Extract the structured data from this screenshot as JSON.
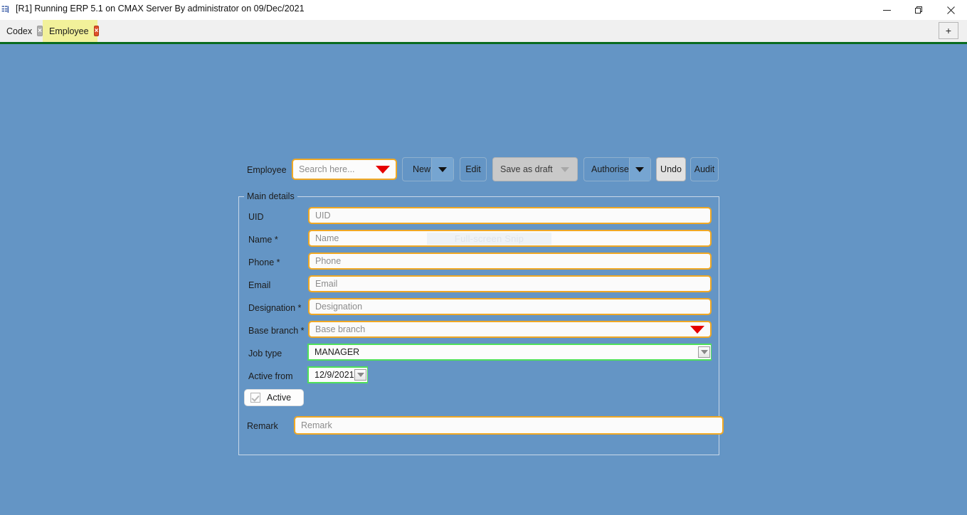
{
  "window": {
    "title": "[R1] Running ERP 5.1 on CMAX Server By administrator on 09/Dec/2021",
    "icon": "app-icon",
    "minimize_label": "Minimize",
    "restore_label": "Restore",
    "close_label": "Close"
  },
  "tabs": {
    "items": [
      {
        "label": "Codex",
        "active": false,
        "close_label": "×"
      },
      {
        "label": "Employee",
        "active": true,
        "close_label": "×"
      }
    ],
    "add_label": "+"
  },
  "toolbar": {
    "record_label": "Employee",
    "search_placeholder": "Search here...",
    "search_value": "",
    "new_label": "New",
    "edit_label": "Edit",
    "save_as_draft_label": "Save as draft",
    "authorise_label": "Authorise",
    "undo_label": "Undo",
    "audit_label": "Audit"
  },
  "main_details": {
    "group_title": "Main details",
    "fields": [
      {
        "label": "UID",
        "placeholder": "UID",
        "value": "",
        "type": "text"
      },
      {
        "label": "Name *",
        "placeholder": "Name",
        "value": "",
        "type": "text"
      },
      {
        "label": "Phone *",
        "placeholder": "Phone",
        "value": "",
        "type": "text"
      },
      {
        "label": "Email",
        "placeholder": "Email",
        "value": "",
        "type": "text"
      },
      {
        "label": "Designation *",
        "placeholder": "Designation",
        "value": "",
        "type": "text"
      },
      {
        "label": "Base branch *",
        "placeholder": "Base branch",
        "value": "",
        "type": "dropdown"
      }
    ],
    "job_type": {
      "label": "Job type",
      "value": "MANAGER"
    },
    "active_from": {
      "label": "Active from",
      "value": "12/9/2021"
    },
    "active_checkbox": {
      "label": "Active",
      "checked": true
    }
  },
  "remark": {
    "label": "Remark",
    "placeholder": "Remark",
    "value": ""
  },
  "overlay": {
    "snip_label": "Full-screen Snip"
  },
  "colors": {
    "workspace": "#6495c5",
    "accent_border": "#f0a824",
    "active_tab": "#f2f19a",
    "tab_underline": "#0a6b1e",
    "combo_green": "#4fe05a",
    "dropdown_red": "#e60000"
  }
}
